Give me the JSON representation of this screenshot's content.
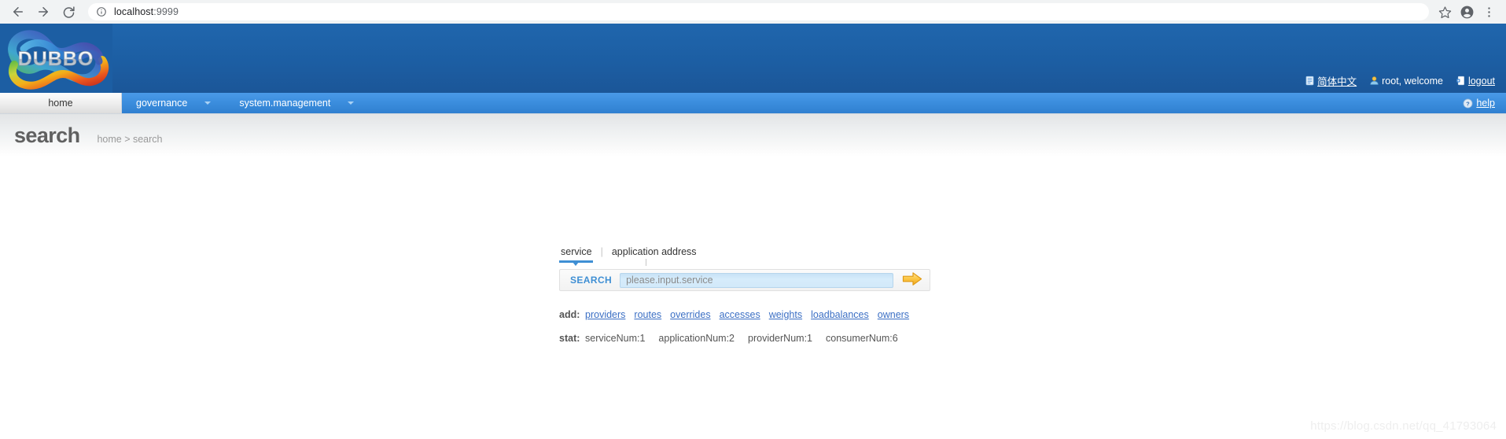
{
  "browser": {
    "back_icon": "arrow-left-icon",
    "forward_icon": "arrow-right-icon",
    "reload_icon": "reload-icon",
    "info_icon": "info-circle-icon",
    "url_host": "localhost",
    "url_port": ":9999",
    "bookmark_icon": "star-icon",
    "profile_icon": "account-circle-icon",
    "menu_icon": "three-dots-menu-icon"
  },
  "header": {
    "logo_alt": "DUBBO",
    "logo_text": "DUBBO",
    "links": [
      {
        "icon": "document-icon",
        "label": "简体中文",
        "is_link": true
      },
      {
        "icon": "user-icon",
        "label": "root, welcome",
        "is_link": false
      },
      {
        "icon": "logout-door-icon",
        "label": "logout",
        "is_link": true
      }
    ]
  },
  "nav": {
    "items": [
      {
        "label": "home",
        "active": true,
        "has_caret": false
      },
      {
        "label": "governance",
        "active": false,
        "has_caret": true
      },
      {
        "label": "system.management",
        "active": false,
        "has_caret": true
      }
    ],
    "help_icon": "help-circle-icon",
    "help_label": "help"
  },
  "page": {
    "title": "search",
    "breadcrumb": "home > search"
  },
  "search": {
    "tabs": [
      {
        "label": "service",
        "active": true
      },
      {
        "label": "application address",
        "active": false
      }
    ],
    "separator": "|",
    "button_label": "SEARCH",
    "input_value": "",
    "placeholder": "please.input.service",
    "go_icon": "arrow-right-go-icon"
  },
  "add": {
    "key": "add:",
    "links": [
      "providers",
      "routes",
      "overrides",
      "accesses",
      "weights",
      "loadbalances",
      "owners"
    ]
  },
  "stat": {
    "key": "stat:",
    "items": [
      "serviceNum:1",
      "applicationNum:2",
      "providerNum:1",
      "consumerNum:6"
    ]
  },
  "watermark": "https://blog.csdn.net/qq_41793064",
  "colors": {
    "header_blue": "#1c5ea3",
    "nav_blue": "#3c8ede",
    "accent_blue": "#3f8fd4",
    "link_blue": "#3b6fc4",
    "go_orange": "#f5a623"
  }
}
